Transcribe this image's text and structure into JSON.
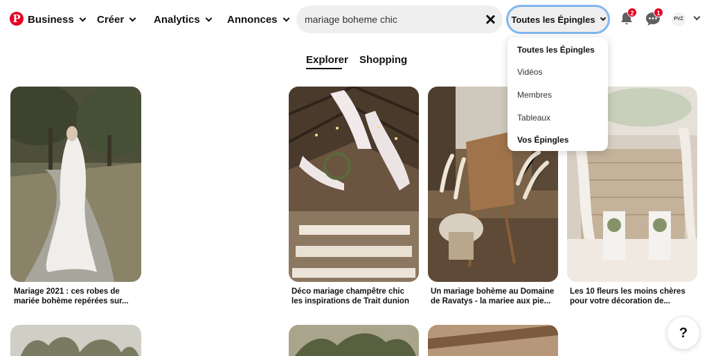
{
  "header": {
    "nav": [
      {
        "label": "Business"
      },
      {
        "label": "Créer"
      },
      {
        "label": "Analytics"
      },
      {
        "label": "Annonces"
      }
    ],
    "search": {
      "value": "mariage boheme chic"
    },
    "filter": {
      "label": "Toutes les Épingles"
    },
    "notifications": {
      "count": "2"
    },
    "messages": {
      "count": "1"
    },
    "avatar": {
      "initials": "PVZ"
    }
  },
  "tabs": [
    {
      "label": "Explorer",
      "active": true
    },
    {
      "label": "Shopping",
      "active": false
    }
  ],
  "dropdown": {
    "items": [
      {
        "label": "Toutes les Épingles",
        "selected": true
      },
      {
        "label": "Vidéos"
      },
      {
        "label": "Membres"
      },
      {
        "label": "Tableaux"
      },
      {
        "label": "Vos Épingles",
        "bold": true
      }
    ]
  },
  "pins": [
    {
      "title_line1": "Mariage 2021 : ces robes de",
      "title_line2": "mariée bohème repérées sur..."
    },
    {
      "title_line1": "Déco mariage champêtre chic",
      "title_line2": "les inspirations de Trait dunion"
    },
    {
      "title_line1": "Un mariage bohème au Domaine",
      "title_line2": "de Ravatys - la mariee aux pie..."
    },
    {
      "title_line1": "Les 10 fleurs les moins chères",
      "title_line2": "pour votre décoration de..."
    }
  ],
  "help": {
    "label": "?"
  },
  "colors": {
    "brand": "#e60023",
    "focus_ring": "#7fb6ef",
    "search_bg": "#efefef"
  }
}
